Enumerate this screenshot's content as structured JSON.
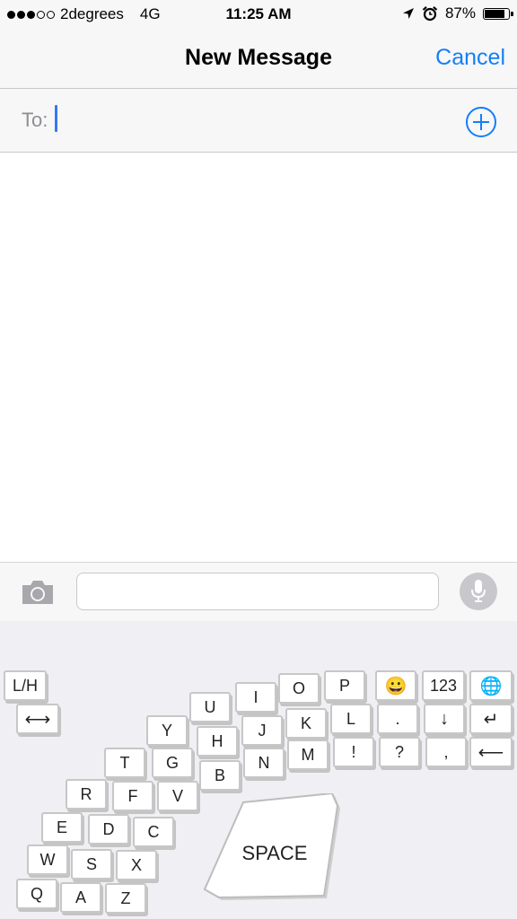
{
  "status": {
    "signal_dots_filled": 3,
    "signal_dots_total": 5,
    "carrier": "2degrees",
    "network": "4G",
    "time": "11:25 AM",
    "battery": "87%",
    "battery_level": 0.87,
    "icons": [
      "location-arrow-icon",
      "alarm-icon",
      "battery-icon"
    ]
  },
  "nav": {
    "title": "New Message",
    "cancel": "Cancel"
  },
  "to_field": {
    "label": "To:",
    "value": "",
    "add_icon": "plus-circle-icon"
  },
  "compose": {
    "camera_icon": "camera-icon",
    "message_value": "",
    "mic_icon": "microphone-icon"
  },
  "keyboard": {
    "keys": [
      {
        "label": "L/H"
      },
      {
        "label": "⟷"
      },
      {
        "label": "U"
      },
      {
        "label": "I"
      },
      {
        "label": "O"
      },
      {
        "label": "P"
      },
      {
        "label": "😀"
      },
      {
        "label": "123"
      },
      {
        "label": "🌐"
      },
      {
        "label": "Y"
      },
      {
        "label": "J"
      },
      {
        "label": "K"
      },
      {
        "label": "L"
      },
      {
        "label": "."
      },
      {
        "label": "↓"
      },
      {
        "label": "↵"
      },
      {
        "label": "T"
      },
      {
        "label": "G"
      },
      {
        "label": "H"
      },
      {
        "label": "N"
      },
      {
        "label": "M"
      },
      {
        "label": "!"
      },
      {
        "label": "?"
      },
      {
        "label": ","
      },
      {
        "label": "⟵"
      },
      {
        "label": "B"
      },
      {
        "label": "R"
      },
      {
        "label": "F"
      },
      {
        "label": "V"
      },
      {
        "label": "E"
      },
      {
        "label": "D"
      },
      {
        "label": "C"
      },
      {
        "label": "W"
      },
      {
        "label": "S"
      },
      {
        "label": "X"
      },
      {
        "label": "Q"
      },
      {
        "label": "A"
      },
      {
        "label": "Z"
      }
    ],
    "space_label": "SPACE"
  },
  "colors": {
    "accent": "#147efb",
    "cursor": "#3478f6",
    "keyboard_bg": "#efeff4",
    "bar_bg": "#f7f7f7"
  }
}
